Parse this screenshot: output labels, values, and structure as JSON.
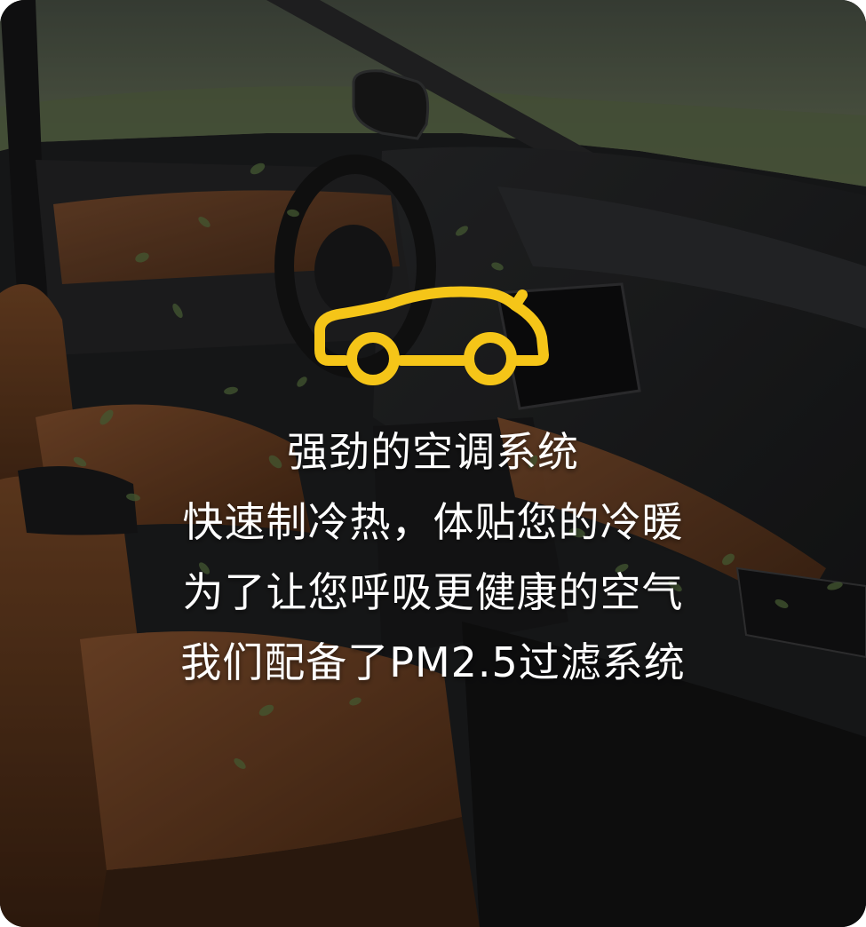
{
  "banner": {
    "icon": "car-icon",
    "icon_color": "#F5C518",
    "lines": [
      "强劲的空调系统",
      "快速制冷热，体贴您的冷暖",
      "为了让您呼吸更健康的空气",
      "我们配备了PM2.5过滤系统"
    ]
  },
  "colors": {
    "overlay": "#000000",
    "text": "#FFFFFF",
    "leather": "#7A4A28",
    "dashboard": "#2A2A2C",
    "leaf": "#5E7A45"
  }
}
